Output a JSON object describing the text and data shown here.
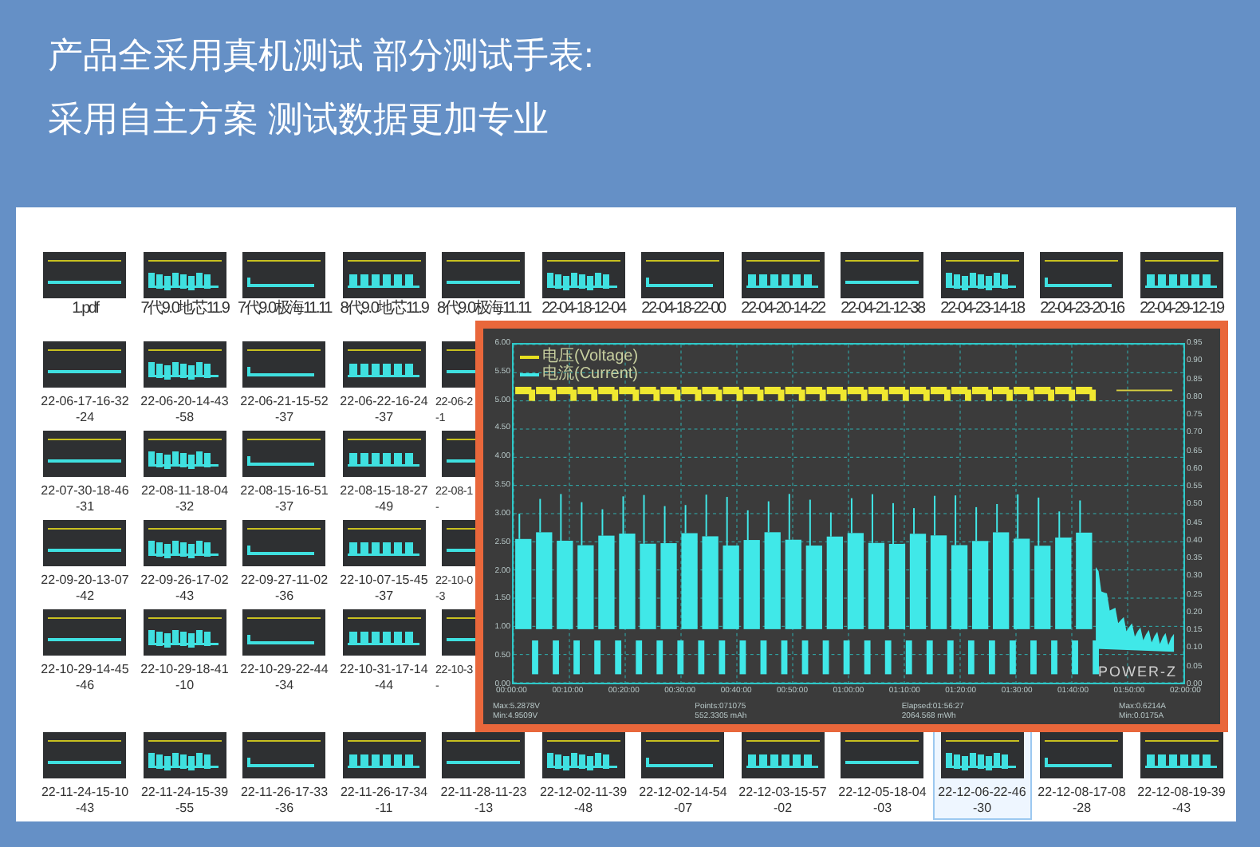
{
  "headline": [
    "产品全采用真机测试  部分测试手表:",
    "采用自主方案 测试数据更加专业"
  ],
  "file_rows": [
    [
      {
        "label": "1.pdf",
        "selected": false
      },
      {
        "label": "7代9.0地芯11.9",
        "selected": false
      },
      {
        "label": "7代9.0极海11.11",
        "selected": false
      },
      {
        "label": "8代9.0地芯11.9",
        "selected": false
      },
      {
        "label": "8代9.0极海11.11",
        "selected": false
      },
      {
        "label": "22-04-18-12-04",
        "selected": false
      },
      {
        "label": "22-04-18-22-00",
        "selected": false
      },
      {
        "label": "22-04-20-14-22",
        "selected": false
      },
      {
        "label": "22-04-21-12-38",
        "selected": false
      },
      {
        "label": "22-04-23-14-18",
        "selected": false
      },
      {
        "label": "22-04-23-20-16",
        "selected": false
      },
      {
        "label": "22-04-29-12-19",
        "selected": false
      }
    ],
    [
      {
        "label": "22-06-17-16-32\n-24",
        "selected": false
      },
      {
        "label": "22-06-20-14-43\n-58",
        "selected": false
      },
      {
        "label": "22-06-21-15-52\n-37",
        "selected": false
      },
      {
        "label": "22-06-22-16-24\n-37",
        "selected": false
      },
      {
        "label": "22-06-2\n-1",
        "selected": false,
        "partial": true
      }
    ],
    [
      {
        "label": "22-07-30-18-46\n-31",
        "selected": false
      },
      {
        "label": "22-08-11-18-04\n-32",
        "selected": false
      },
      {
        "label": "22-08-15-16-51\n-37",
        "selected": false
      },
      {
        "label": "22-08-15-18-27\n-49",
        "selected": false
      },
      {
        "label": "22-08-1\n-",
        "selected": false,
        "partial": true
      }
    ],
    [
      {
        "label": "22-09-20-13-07\n-42",
        "selected": false
      },
      {
        "label": "22-09-26-17-02\n-43",
        "selected": false
      },
      {
        "label": "22-09-27-11-02\n-36",
        "selected": false
      },
      {
        "label": "22-10-07-15-45\n-37",
        "selected": false
      },
      {
        "label": "22-10-0\n-3",
        "selected": false,
        "partial": true
      }
    ],
    [
      {
        "label": "22-10-29-14-45\n-46",
        "selected": false
      },
      {
        "label": "22-10-29-18-41\n-10",
        "selected": false
      },
      {
        "label": "22-10-29-22-44\n-34",
        "selected": false
      },
      {
        "label": "22-10-31-17-14\n-44",
        "selected": false
      },
      {
        "label": "22-10-3\n-",
        "selected": false,
        "partial": true
      }
    ],
    [
      {
        "label": "22-11-24-15-10\n-43",
        "selected": false
      },
      {
        "label": "22-11-24-15-39\n-55",
        "selected": false
      },
      {
        "label": "22-11-26-17-33\n-36",
        "selected": false
      },
      {
        "label": "22-11-26-17-34\n-11",
        "selected": false
      },
      {
        "label": "22-11-28-11-23\n-13",
        "selected": false
      },
      {
        "label": "22-12-02-11-39\n-48",
        "selected": false
      },
      {
        "label": "22-12-02-14-54\n-07",
        "selected": false
      },
      {
        "label": "22-12-03-15-57\n-02",
        "selected": false
      },
      {
        "label": "22-12-05-18-04\n-03",
        "selected": false
      },
      {
        "label": "22-12-06-22-46\n-30",
        "selected": true
      },
      {
        "label": "22-12-08-17-08\n-28",
        "selected": false
      },
      {
        "label": "22-12-08-19-39\n-43",
        "selected": false
      }
    ]
  ],
  "chart_preview": {
    "legend": [
      {
        "label": "电压(Voltage)",
        "color": "#e8e020"
      },
      {
        "label": "电流(Current)",
        "color": "#40e8e8"
      }
    ],
    "left_ticks": [
      "6.00",
      "5.50",
      "5.00",
      "4.50",
      "4.00",
      "3.50",
      "3.00",
      "2.50",
      "2.00",
      "1.50",
      "1.00",
      "0.50",
      "0.00"
    ],
    "right_ticks": [
      "0.95",
      "0.90",
      "0.85",
      "0.80",
      "0.75",
      "0.70",
      "0.65",
      "0.60",
      "0.55",
      "0.50",
      "0.45",
      "0.40",
      "0.35",
      "0.30",
      "0.25",
      "0.20",
      "0.15",
      "0.10",
      "0.05",
      "0.00"
    ],
    "x_ticks": [
      "00:00:00",
      "00:10:00",
      "00:20:00",
      "00:30:00",
      "00:40:00",
      "00:50:00",
      "01:00:00",
      "01:10:00",
      "01:20:00",
      "01:30:00",
      "01:40:00",
      "01:50:00",
      "02:00:00"
    ],
    "brand": "POWER-Z",
    "stats": [
      [
        "Max:5.2878V",
        "Min:4.9509V"
      ],
      [
        "Points:071075",
        "552.3305 mAh"
      ],
      [
        "Elapsed:01:56:27",
        "2064.568 mWh"
      ],
      [
        "Max:0.6214A",
        "Min:0.0175A"
      ]
    ]
  }
}
